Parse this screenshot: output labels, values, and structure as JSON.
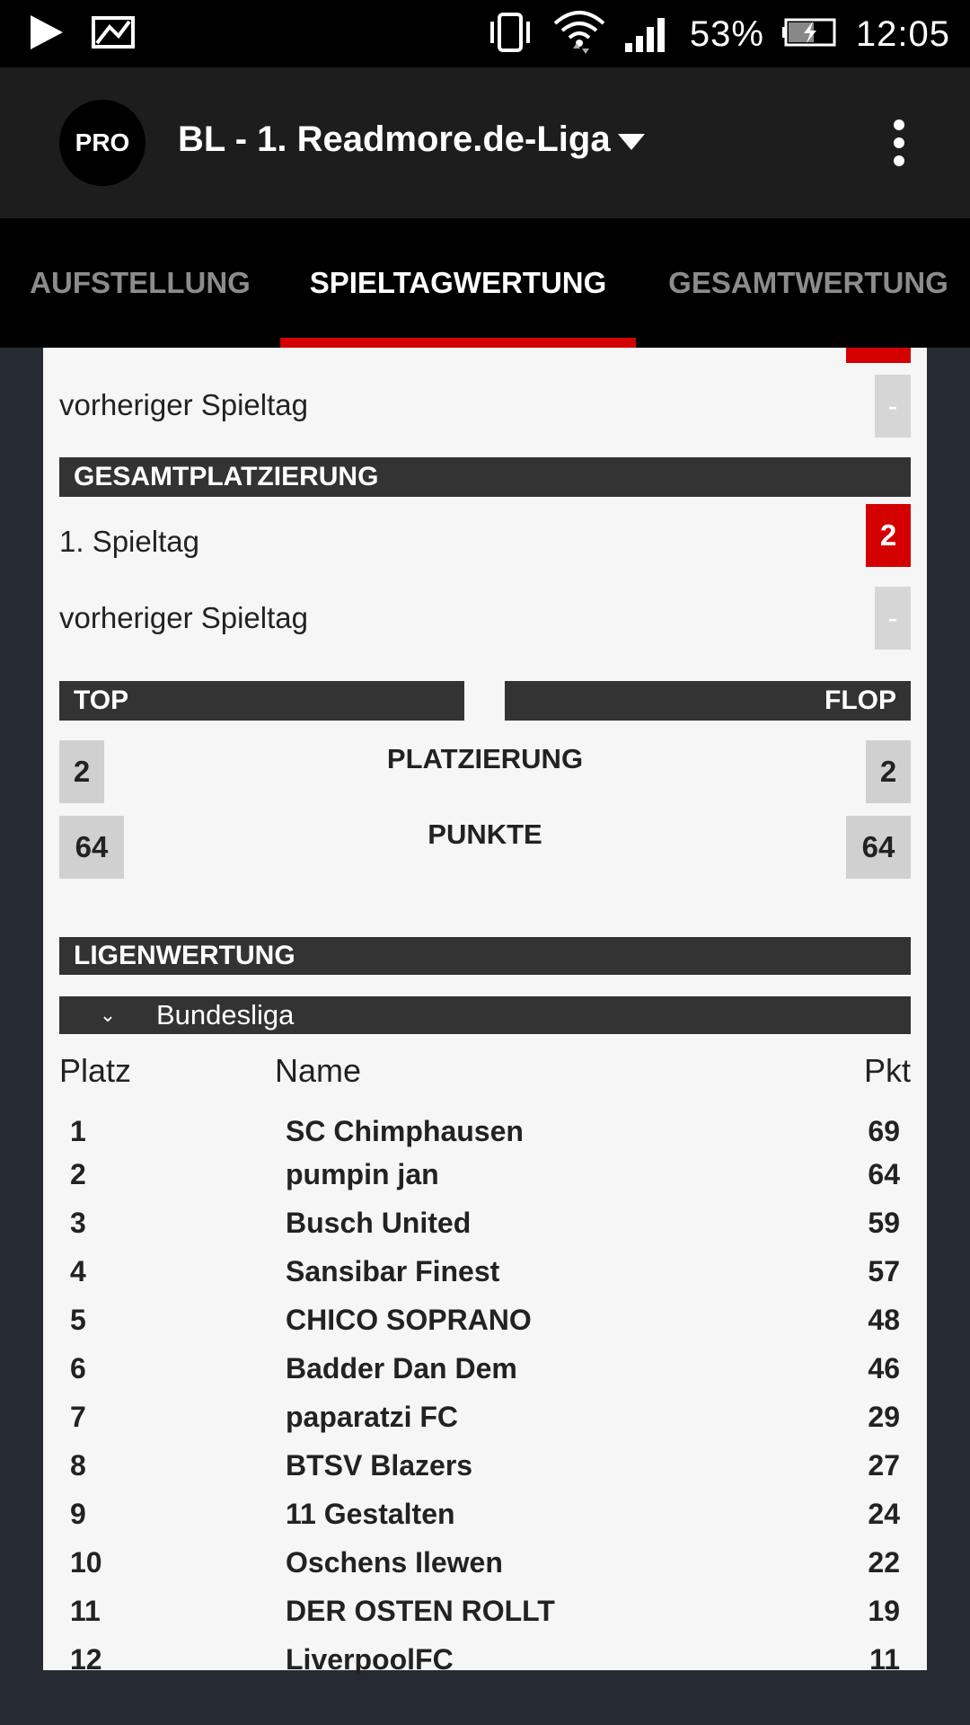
{
  "statusbar": {
    "battery": "53%",
    "time": "12:05"
  },
  "appbar": {
    "badge": "PRO",
    "title": "BL - 1. Readmore.de-Liga"
  },
  "tabs": [
    {
      "label": "AUFSTELLUNG",
      "active": false
    },
    {
      "label": "SPIELTAGWERTUNG",
      "active": true
    },
    {
      "label": "GESAMTWERTUNG",
      "active": false
    }
  ],
  "spieltag": {
    "previous_label": "vorheriger Spieltag",
    "previous_value": "-"
  },
  "gesamtplatzierung": {
    "header": "GESAMTPLATZIERUNG",
    "current_label": "1. Spieltag",
    "current_value": "2",
    "previous_label": "vorheriger Spieltag",
    "previous_value": "-"
  },
  "top_flop": {
    "top_label": "TOP",
    "flop_label": "FLOP",
    "platz_label": "PLATZIERUNG",
    "punkte_label": "PUNKTE",
    "top_platz": "2",
    "flop_platz": "2",
    "top_punkte": "64",
    "flop_punkte": "64"
  },
  "ligenwertung": {
    "header": "LIGENWERTUNG",
    "selected_league": "Bundesliga",
    "columns": {
      "platz": "Platz",
      "name": "Name",
      "pkt": "Pkt"
    },
    "rows": [
      {
        "platz": "1",
        "name": "SC Chimphausen",
        "pkt": "69"
      },
      {
        "platz": "2",
        "name": "pumpin jan",
        "pkt": "64"
      },
      {
        "platz": "3",
        "name": "Busch United",
        "pkt": "59"
      },
      {
        "platz": "4",
        "name": "Sansibar Finest",
        "pkt": "57"
      },
      {
        "platz": "5",
        "name": "CHICO SOPRANO",
        "pkt": "48"
      },
      {
        "platz": "6",
        "name": "Badder Dan Dem",
        "pkt": "46"
      },
      {
        "platz": "7",
        "name": "paparatzi FC",
        "pkt": "29"
      },
      {
        "platz": "8",
        "name": "BTSV Blazers",
        "pkt": "27"
      },
      {
        "platz": "9",
        "name": "11 Gestalten",
        "pkt": "24"
      },
      {
        "platz": "10",
        "name": "Oschens Ilewen",
        "pkt": "22"
      },
      {
        "platz": "11",
        "name": "DER OSTEN ROLLT",
        "pkt": "19"
      },
      {
        "platz": "12",
        "name": "LiverpoolFC",
        "pkt": "11"
      }
    ]
  },
  "colors": {
    "accent": "#d40000",
    "dark_bar": "#333333",
    "background": "#262b33"
  }
}
